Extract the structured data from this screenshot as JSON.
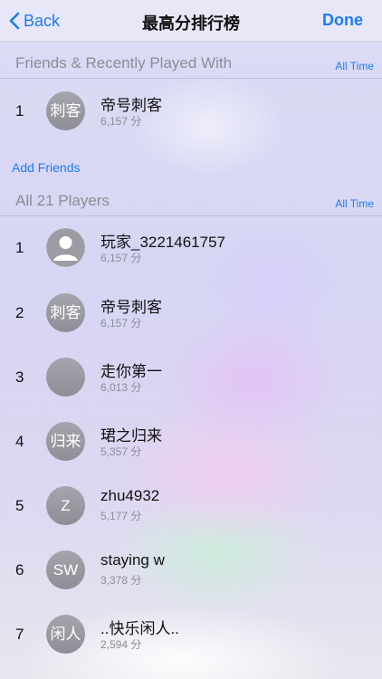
{
  "nav": {
    "back_label": "Back",
    "title": "最高分排行榜",
    "done_label": "Done"
  },
  "friends_section": {
    "title": "Friends & Recently Played With",
    "filter": "All Time",
    "rows": [
      {
        "rank": "1",
        "avatar_text": "刺客",
        "name": "帝号刺客",
        "score": "6,157 分"
      }
    ]
  },
  "add_friends_label": "Add Friends",
  "all_section": {
    "title": "All 21 Players",
    "filter": "All Time",
    "rows": [
      {
        "rank": "1",
        "avatar_text": "",
        "avatar_icon": "default-person-icon",
        "name": "玩家_3221461757",
        "score": "6,157 分"
      },
      {
        "rank": "2",
        "avatar_text": "刺客",
        "name": "帝号刺客",
        "score": "6,157 分"
      },
      {
        "rank": "3",
        "avatar_text": "",
        "name": "走你第一",
        "score": "6,013 分"
      },
      {
        "rank": "4",
        "avatar_text": "归来",
        "name": "珺之归来",
        "score": "5,357 分"
      },
      {
        "rank": "5",
        "avatar_text": "Z",
        "name": "zhu4932",
        "score": "5,177 分"
      },
      {
        "rank": "6",
        "avatar_text": "SW",
        "name": "staying w",
        "score": "3,378 分"
      },
      {
        "rank": "7",
        "avatar_text": "闲人",
        "name": "..快乐闲人..",
        "score": "2,594 分"
      }
    ]
  },
  "colors": {
    "accent": "#1e7cf2",
    "secondary_text": "#8c8c96",
    "avatar_gray": "#9a9aa2"
  }
}
